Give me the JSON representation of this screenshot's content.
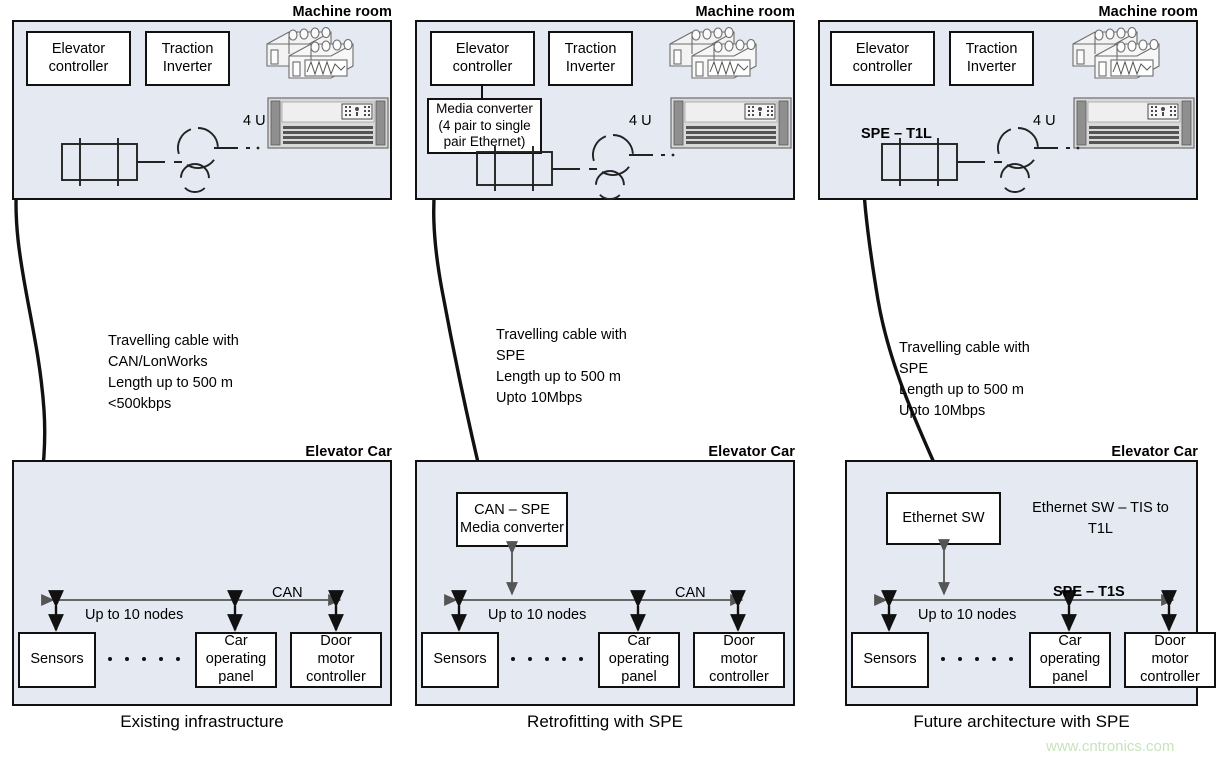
{
  "figure": {
    "title": "Elevator network architecture comparison: existing, retrofit and future SPE",
    "panel_fill": "#e4e9f2",
    "panel_stroke": "#111111",
    "watermark": "www.cntronics.com",
    "watermark_color": "#c8e3bc"
  },
  "columns": [
    {
      "caption": "Existing infrastructure",
      "machine_room": {
        "title": "Machine room",
        "boxes": [
          {
            "name": "elevator-controller",
            "label": "Elevator\ncontroller"
          },
          {
            "name": "traction-inverter",
            "label": "Traction\nInverter"
          }
        ],
        "unit_label": "4 U",
        "bus_label": "",
        "icons": [
          "battery-bank-icon",
          "rack-server-icon",
          "motor-pulley-schematic-icon"
        ]
      },
      "link_text": "Travelling cable with\nCAN/LonWorks\nLength up to 500 m\n<500kbps",
      "elevator_car": {
        "title": "Elevator Car",
        "converter": null,
        "converter_note": "",
        "bus_name": "CAN",
        "nodes_label": "Up to 10 nodes",
        "dot_count": 5,
        "devices": [
          {
            "name": "sensors",
            "label": "Sensors"
          },
          {
            "name": "car-operating-panel",
            "label": "Car\noperating\npanel"
          },
          {
            "name": "door-motor-controller",
            "label": "Door\nmotor\ncontroller"
          }
        ]
      }
    },
    {
      "caption": "Retrofitting with SPE",
      "machine_room": {
        "title": "Machine room",
        "boxes": [
          {
            "name": "elevator-controller",
            "label": "Elevator\ncontroller"
          },
          {
            "name": "traction-inverter",
            "label": "Traction\nInverter"
          },
          {
            "name": "media-converter",
            "label": "Media converter\n(4 pair to single\npair Ethernet)"
          }
        ],
        "unit_label": "4 U",
        "bus_label": "",
        "icons": [
          "battery-bank-icon",
          "rack-server-icon",
          "motor-pulley-schematic-icon"
        ]
      },
      "link_text": "Travelling cable with\nSPE\nLength up to 500 m\nUpto 10Mbps",
      "elevator_car": {
        "title": "Elevator Car",
        "converter": {
          "name": "can-spe-media-converter",
          "label": "CAN – SPE\nMedia converter"
        },
        "converter_note": "",
        "bus_name": "CAN",
        "nodes_label": "Up to 10 nodes",
        "dot_count": 5,
        "devices": [
          {
            "name": "sensors",
            "label": "Sensors"
          },
          {
            "name": "car-operating-panel",
            "label": "Car\noperating\npanel"
          },
          {
            "name": "door-motor-controller",
            "label": "Door\nmotor\ncontroller"
          }
        ]
      }
    },
    {
      "caption": "Future architecture with SPE",
      "machine_room": {
        "title": "Machine room",
        "boxes": [
          {
            "name": "elevator-controller",
            "label": "Elevator\ncontroller"
          },
          {
            "name": "traction-inverter",
            "label": "Traction\nInverter"
          }
        ],
        "unit_label": "4 U",
        "bus_label": "SPE – T1L",
        "icons": [
          "battery-bank-icon",
          "rack-server-icon",
          "motor-pulley-schematic-icon"
        ]
      },
      "link_text": "Travelling cable with\nSPE\nLength up to 500 m\nUpto 10Mbps",
      "elevator_car": {
        "title": "Elevator Car",
        "converter": {
          "name": "ethernet-switch",
          "label": "Ethernet SW"
        },
        "converter_note": "Ethernet SW – TIS to\nT1L",
        "bus_name": "SPE – T1S",
        "nodes_label": "Up to 10 nodes",
        "dot_count": 5,
        "devices": [
          {
            "name": "sensors",
            "label": "Sensors"
          },
          {
            "name": "car-operating-panel",
            "label": "Car\noperating\npanel"
          },
          {
            "name": "door-motor-controller",
            "label": "Door\nmotor\ncontroller"
          }
        ]
      }
    }
  ]
}
